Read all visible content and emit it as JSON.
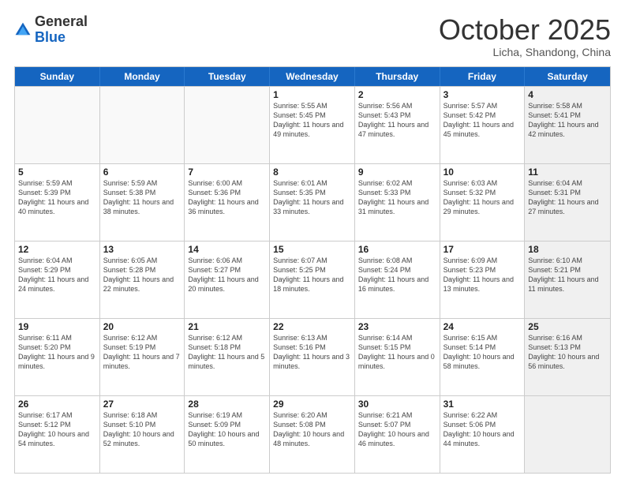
{
  "header": {
    "logo_general": "General",
    "logo_blue": "Blue",
    "month": "October 2025",
    "location": "Licha, Shandong, China"
  },
  "weekdays": [
    "Sunday",
    "Monday",
    "Tuesday",
    "Wednesday",
    "Thursday",
    "Friday",
    "Saturday"
  ],
  "rows": [
    [
      {
        "day": "",
        "info": "",
        "empty": true
      },
      {
        "day": "",
        "info": "",
        "empty": true
      },
      {
        "day": "",
        "info": "",
        "empty": true
      },
      {
        "day": "1",
        "info": "Sunrise: 5:55 AM\nSunset: 5:45 PM\nDaylight: 11 hours\nand 49 minutes."
      },
      {
        "day": "2",
        "info": "Sunrise: 5:56 AM\nSunset: 5:43 PM\nDaylight: 11 hours\nand 47 minutes."
      },
      {
        "day": "3",
        "info": "Sunrise: 5:57 AM\nSunset: 5:42 PM\nDaylight: 11 hours\nand 45 minutes."
      },
      {
        "day": "4",
        "info": "Sunrise: 5:58 AM\nSunset: 5:41 PM\nDaylight: 11 hours\nand 42 minutes.",
        "shaded": true
      }
    ],
    [
      {
        "day": "5",
        "info": "Sunrise: 5:59 AM\nSunset: 5:39 PM\nDaylight: 11 hours\nand 40 minutes."
      },
      {
        "day": "6",
        "info": "Sunrise: 5:59 AM\nSunset: 5:38 PM\nDaylight: 11 hours\nand 38 minutes."
      },
      {
        "day": "7",
        "info": "Sunrise: 6:00 AM\nSunset: 5:36 PM\nDaylight: 11 hours\nand 36 minutes."
      },
      {
        "day": "8",
        "info": "Sunrise: 6:01 AM\nSunset: 5:35 PM\nDaylight: 11 hours\nand 33 minutes."
      },
      {
        "day": "9",
        "info": "Sunrise: 6:02 AM\nSunset: 5:33 PM\nDaylight: 11 hours\nand 31 minutes."
      },
      {
        "day": "10",
        "info": "Sunrise: 6:03 AM\nSunset: 5:32 PM\nDaylight: 11 hours\nand 29 minutes."
      },
      {
        "day": "11",
        "info": "Sunrise: 6:04 AM\nSunset: 5:31 PM\nDaylight: 11 hours\nand 27 minutes.",
        "shaded": true
      }
    ],
    [
      {
        "day": "12",
        "info": "Sunrise: 6:04 AM\nSunset: 5:29 PM\nDaylight: 11 hours\nand 24 minutes."
      },
      {
        "day": "13",
        "info": "Sunrise: 6:05 AM\nSunset: 5:28 PM\nDaylight: 11 hours\nand 22 minutes."
      },
      {
        "day": "14",
        "info": "Sunrise: 6:06 AM\nSunset: 5:27 PM\nDaylight: 11 hours\nand 20 minutes."
      },
      {
        "day": "15",
        "info": "Sunrise: 6:07 AM\nSunset: 5:25 PM\nDaylight: 11 hours\nand 18 minutes."
      },
      {
        "day": "16",
        "info": "Sunrise: 6:08 AM\nSunset: 5:24 PM\nDaylight: 11 hours\nand 16 minutes."
      },
      {
        "day": "17",
        "info": "Sunrise: 6:09 AM\nSunset: 5:23 PM\nDaylight: 11 hours\nand 13 minutes."
      },
      {
        "day": "18",
        "info": "Sunrise: 6:10 AM\nSunset: 5:21 PM\nDaylight: 11 hours\nand 11 minutes.",
        "shaded": true
      }
    ],
    [
      {
        "day": "19",
        "info": "Sunrise: 6:11 AM\nSunset: 5:20 PM\nDaylight: 11 hours\nand 9 minutes."
      },
      {
        "day": "20",
        "info": "Sunrise: 6:12 AM\nSunset: 5:19 PM\nDaylight: 11 hours\nand 7 minutes."
      },
      {
        "day": "21",
        "info": "Sunrise: 6:12 AM\nSunset: 5:18 PM\nDaylight: 11 hours\nand 5 minutes."
      },
      {
        "day": "22",
        "info": "Sunrise: 6:13 AM\nSunset: 5:16 PM\nDaylight: 11 hours\nand 3 minutes."
      },
      {
        "day": "23",
        "info": "Sunrise: 6:14 AM\nSunset: 5:15 PM\nDaylight: 11 hours\nand 0 minutes."
      },
      {
        "day": "24",
        "info": "Sunrise: 6:15 AM\nSunset: 5:14 PM\nDaylight: 10 hours\nand 58 minutes."
      },
      {
        "day": "25",
        "info": "Sunrise: 6:16 AM\nSunset: 5:13 PM\nDaylight: 10 hours\nand 56 minutes.",
        "shaded": true
      }
    ],
    [
      {
        "day": "26",
        "info": "Sunrise: 6:17 AM\nSunset: 5:12 PM\nDaylight: 10 hours\nand 54 minutes."
      },
      {
        "day": "27",
        "info": "Sunrise: 6:18 AM\nSunset: 5:10 PM\nDaylight: 10 hours\nand 52 minutes."
      },
      {
        "day": "28",
        "info": "Sunrise: 6:19 AM\nSunset: 5:09 PM\nDaylight: 10 hours\nand 50 minutes."
      },
      {
        "day": "29",
        "info": "Sunrise: 6:20 AM\nSunset: 5:08 PM\nDaylight: 10 hours\nand 48 minutes."
      },
      {
        "day": "30",
        "info": "Sunrise: 6:21 AM\nSunset: 5:07 PM\nDaylight: 10 hours\nand 46 minutes."
      },
      {
        "day": "31",
        "info": "Sunrise: 6:22 AM\nSunset: 5:06 PM\nDaylight: 10 hours\nand 44 minutes."
      },
      {
        "day": "",
        "info": "",
        "empty": true,
        "shaded": true
      }
    ]
  ]
}
